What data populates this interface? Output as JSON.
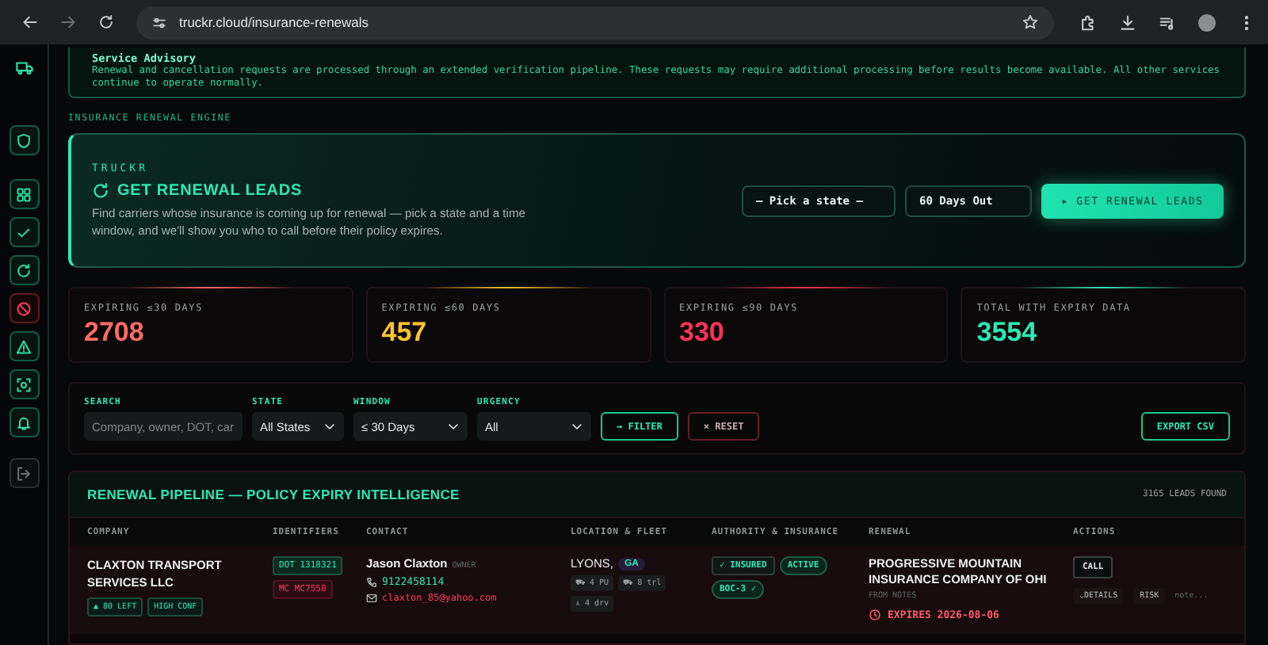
{
  "browser": {
    "url": "truckr.cloud/insurance-renewals"
  },
  "sidebar": {
    "items": [
      {
        "kind": "truck"
      },
      {
        "kind": "shield"
      },
      {
        "kind": "grid"
      },
      {
        "kind": "check"
      },
      {
        "kind": "refresh"
      },
      {
        "kind": "ban"
      },
      {
        "kind": "warning"
      },
      {
        "kind": "scan"
      },
      {
        "kind": "bell"
      },
      {
        "kind": "logout"
      }
    ]
  },
  "advisory": {
    "title": "Service Advisory",
    "text": "Renewal and cancellation requests are processed through an extended verification pipeline. These requests may require additional processing before results become available. All other services continue to operate normally."
  },
  "section_label": "INSURANCE RENEWAL ENGINE",
  "hero": {
    "brand": "TRUCKR",
    "title": "GET RENEWAL LEADS",
    "description": "Find carriers whose insurance is coming up for renewal — pick a state and a time window, and we'll show you who to call before their policy expires.",
    "state_select": "– Pick a state –",
    "window_select": "60 Days Out",
    "button": "▸ GET RENEWAL LEADS"
  },
  "stats": [
    {
      "label": "EXPIRING ≤30 DAYS",
      "value": "2708",
      "color": "#ff6b63"
    },
    {
      "label": "EXPIRING ≤60 DAYS",
      "value": "457",
      "color": "#ffc22e"
    },
    {
      "label": "EXPIRING ≤90 DAYS",
      "value": "330",
      "color": "#ff3355"
    },
    {
      "label": "TOTAL WITH EXPIRY DATA",
      "value": "3554",
      "color": "#2ee8b4"
    }
  ],
  "filters": {
    "fields": [
      {
        "kind": "text",
        "label": "SEARCH",
        "placeholder": "Company, owner, DOT, car"
      },
      {
        "kind": "select",
        "label": "STATE",
        "value": "All States"
      },
      {
        "kind": "select",
        "label": "WINDOW",
        "value": "≤ 30 Days"
      },
      {
        "kind": "select",
        "label": "URGENCY",
        "value": "All"
      }
    ],
    "filter_button": "→ FILTER",
    "reset_button": "× RESET",
    "export_button": "EXPORT CSV"
  },
  "table": {
    "title": "RENEWAL PIPELINE — POLICY EXPIRY INTELLIGENCE",
    "count": "3165 LEADS FOUND",
    "columns": [
      "COMPANY",
      "IDENTIFIERS",
      "CONTACT",
      "LOCATION & FLEET",
      "AUTHORITY & INSURANCE",
      "RENEWAL",
      "ACTIONS"
    ],
    "rows": [
      {
        "company": "CLAXTON TRANSPORT SERVICES LLC",
        "badges": [
          "▲ 80 LEFT",
          "HIGH CONF"
        ],
        "identifiers": [
          {
            "text": "DOT 1318321",
            "kind": "good"
          },
          {
            "text": "MC MC7558",
            "kind": "bad"
          }
        ],
        "contact": {
          "name": "Jason Claxton",
          "role": "OWNER",
          "phone": "9122458114",
          "email": "claxton_85@yahoo.com"
        },
        "location": {
          "city": "LYONS,",
          "state": "GA",
          "chips": [
            "⛟ 4 PU",
            "⛟ 8 trl",
            "♙ 4 drv"
          ]
        },
        "authority": [
          {
            "text": "✓ INSURED",
            "kind": "box"
          },
          {
            "text": "ACTIVE",
            "kind": "pill"
          },
          {
            "text": "BOC-3 ✓",
            "kind": "pill"
          }
        ],
        "renewal": {
          "insurer": "PROGRESSIVE MOUNTAIN INSURANCE COMPANY OF OHI",
          "source": "FROM NOTES",
          "expires": "EXPIRES 2026-08-06"
        },
        "actions": {
          "call": "CALL",
          "details": "⌄DETAILS",
          "risk": "RISK",
          "note": "note..."
        }
      }
    ]
  }
}
